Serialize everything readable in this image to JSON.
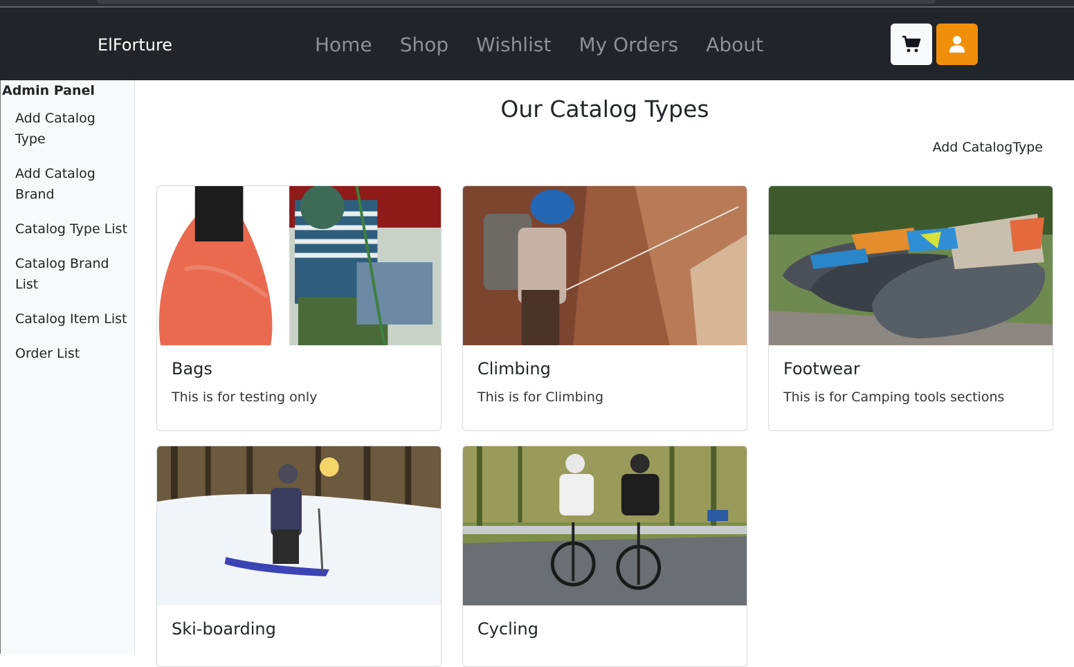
{
  "navbar": {
    "brand": "ElForture",
    "links": [
      "Home",
      "Shop",
      "Wishlist",
      "My Orders",
      "About"
    ],
    "cart_icon": "cart-icon",
    "user_icon": "user-icon",
    "user_button_color": "#f0900a"
  },
  "sidebar": {
    "title": "Admin Panel",
    "items": [
      {
        "label": "Add Catalog Type"
      },
      {
        "label": "Add Catalog Brand"
      },
      {
        "label": "Catalog Type List"
      },
      {
        "label": "Catalog Brand List"
      },
      {
        "label": "Catalog Item List"
      },
      {
        "label": "Order List"
      }
    ]
  },
  "main": {
    "title": "Our Catalog Types",
    "add_link": "Add CatalogType",
    "cards": [
      {
        "title": "Bags",
        "text": "This is for testing only"
      },
      {
        "title": "Climbing",
        "text": "This is for Climbing"
      },
      {
        "title": "Footwear",
        "text": "This is for Camping tools sections"
      },
      {
        "title": "Ski-boarding",
        "text": ""
      },
      {
        "title": "Cycling",
        "text": ""
      }
    ]
  }
}
